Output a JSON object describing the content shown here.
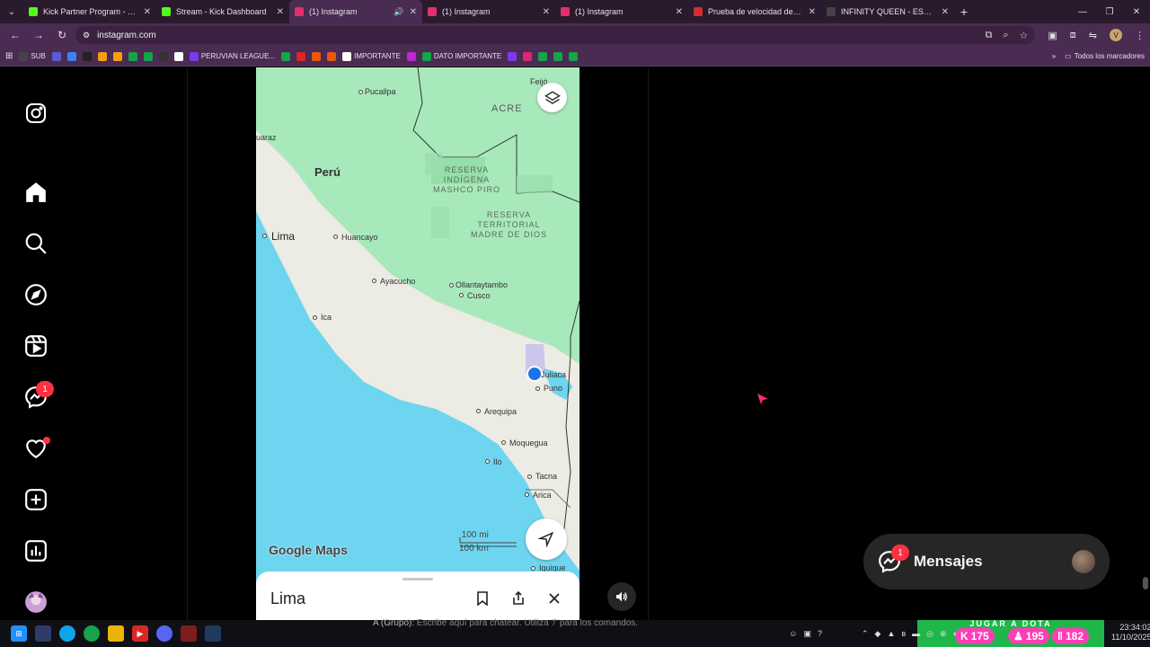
{
  "browser": {
    "tabs": [
      {
        "label": "Kick Partner Program - Kick Da",
        "favicon_color": "#53fc18",
        "active": false
      },
      {
        "label": "Stream - Kick Dashboard",
        "favicon_color": "#53fc18",
        "active": false
      },
      {
        "label": "(1) Instagram",
        "favicon_color": "#e1306c",
        "active": true
      },
      {
        "label": "(1) Instagram",
        "favicon_color": "#e1306c",
        "active": false
      },
      {
        "label": "(1) Instagram",
        "favicon_color": "#e1306c",
        "active": false
      },
      {
        "label": "Prueba de velocidad de Interne",
        "favicon_color": "#d32f2f",
        "active": false
      },
      {
        "label": "INFINITY QUEEN - ESPORTS FE",
        "favicon_color": "#444444",
        "active": false
      }
    ],
    "url": "instagram.com",
    "bookmarks": [
      {
        "label": "SUB",
        "color": "#444"
      },
      {
        "label": "",
        "color": "#5b5bd6"
      },
      {
        "label": "",
        "color": "#3b82f6"
      },
      {
        "label": "",
        "color": "#222"
      },
      {
        "label": "",
        "color": "#f59e0b"
      },
      {
        "label": "",
        "color": "#f59e0b"
      },
      {
        "label": "",
        "color": "#16a34a"
      },
      {
        "label": "",
        "color": "#16a34a"
      },
      {
        "label": "",
        "color": "#333"
      },
      {
        "label": "",
        "color": "#fff"
      },
      {
        "label": "PERUVIAN LEAGUE...",
        "color": "#7c3aed"
      },
      {
        "label": "",
        "color": "#16a34a"
      },
      {
        "label": "",
        "color": "#dc2626"
      },
      {
        "label": "",
        "color": "#ea580c"
      },
      {
        "label": "",
        "color": "#ea580c"
      },
      {
        "label": "IMPORTANTE",
        "color": "#ffffff"
      },
      {
        "label": "",
        "color": "#c026d3"
      },
      {
        "label": "DATO IMPORTANTE",
        "color": "#16a34a"
      },
      {
        "label": "",
        "color": "#7c3aed"
      },
      {
        "label": "",
        "color": "#db2777"
      },
      {
        "label": "",
        "color": "#16a34a"
      },
      {
        "label": "",
        "color": "#16a34a"
      },
      {
        "label": "",
        "color": "#16a34a"
      }
    ],
    "all_bookmarks": "Todos los marcadores"
  },
  "story": {
    "map": {
      "labels": {
        "pucallpa": "Pucallpa",
        "acre": "ACRE",
        "feijo": "Feijó",
        "juaraz": "uaraz",
        "peru": "Perú",
        "reserva1": "RESERVA\nINDÍGENA\nMASHCO PIRO",
        "reserva2": "RESERVA\nTERRITORIAL\nMADRE DE DIOS",
        "lima": "Lima",
        "huancayo": "Huancayo",
        "ayacucho": "Ayacucho",
        "ollantaytambo": "Ollantaytambo",
        "cusco": "Cusco",
        "ica": "Ica",
        "juliaca": "Juliaca",
        "puno": "Puno",
        "arequipa": "Arequipa",
        "moquegua": "Moquegua",
        "ilo": "Ilo",
        "tacna": "Tacna",
        "arica": "Arica",
        "iquique": "Iquique"
      },
      "brand": "Google Maps",
      "scale_mi": "100 mi",
      "scale_km": "100 km"
    },
    "sheet_title": "Lima"
  },
  "instagram": {
    "notifications_badge": "1",
    "messages_label": "Mensajes",
    "messages_badge": "1"
  },
  "chat": {
    "group": "A (Grupo):",
    "placeholder": "Escribe aquí para chatear. Utiliza '/' para los comandos."
  },
  "overlay": {
    "banner": "JUGAR A DOTA",
    "kick_count": "175",
    "viewers": "195",
    "stat3": "182"
  },
  "clock": {
    "time": "23:34:02",
    "date": "11/10/2025"
  }
}
